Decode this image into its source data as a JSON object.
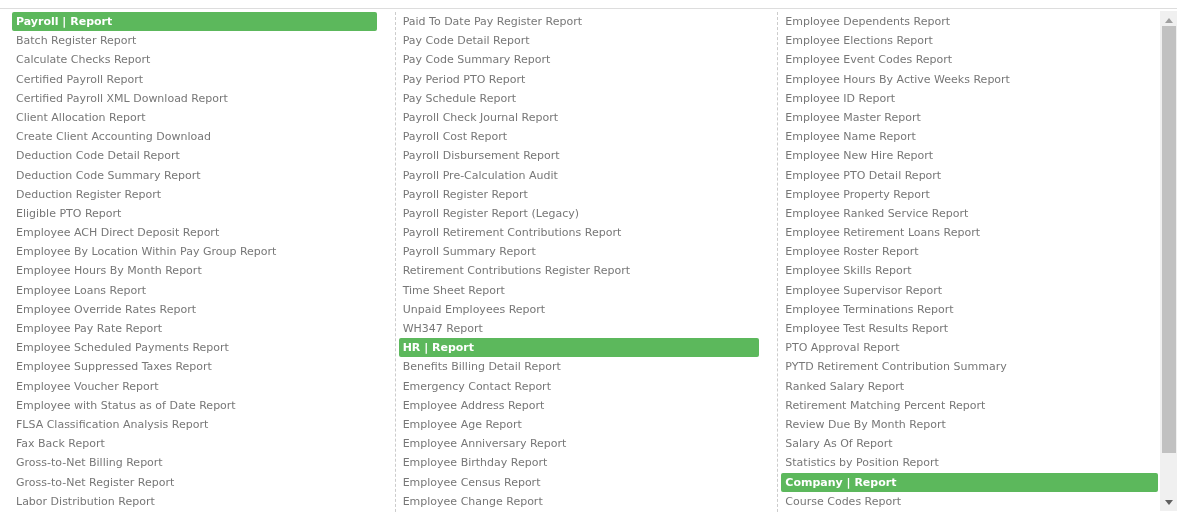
{
  "columns": [
    {
      "items": [
        {
          "label": "Payroll | Report",
          "kind": "header"
        },
        {
          "label": "Batch Register Report",
          "kind": "item"
        },
        {
          "label": "Calculate Checks Report",
          "kind": "item"
        },
        {
          "label": "Certified Payroll Report",
          "kind": "item"
        },
        {
          "label": "Certified Payroll XML Download Report",
          "kind": "item"
        },
        {
          "label": "Client Allocation Report",
          "kind": "item"
        },
        {
          "label": "Create Client Accounting Download",
          "kind": "item"
        },
        {
          "label": "Deduction Code Detail Report",
          "kind": "item"
        },
        {
          "label": "Deduction Code Summary Report",
          "kind": "item"
        },
        {
          "label": "Deduction Register Report",
          "kind": "item"
        },
        {
          "label": "Eligible PTO Report",
          "kind": "item"
        },
        {
          "label": "Employee ACH Direct Deposit Report",
          "kind": "item"
        },
        {
          "label": "Employee By Location Within Pay Group Report",
          "kind": "item"
        },
        {
          "label": "Employee Hours By Month Report",
          "kind": "item"
        },
        {
          "label": "Employee Loans Report",
          "kind": "item"
        },
        {
          "label": "Employee Override Rates Report",
          "kind": "item"
        },
        {
          "label": "Employee Pay Rate Report",
          "kind": "item"
        },
        {
          "label": "Employee Scheduled Payments Report",
          "kind": "item"
        },
        {
          "label": "Employee Suppressed Taxes Report",
          "kind": "item"
        },
        {
          "label": "Employee Voucher Report",
          "kind": "item"
        },
        {
          "label": "Employee with Status as of Date Report",
          "kind": "item"
        },
        {
          "label": "FLSA Classification Analysis Report",
          "kind": "item"
        },
        {
          "label": "Fax Back Report",
          "kind": "item"
        },
        {
          "label": "Gross-to-Net Billing Report",
          "kind": "item"
        },
        {
          "label": "Gross-to-Net Register Report",
          "kind": "item"
        },
        {
          "label": "Labor Distribution Report",
          "kind": "item"
        }
      ]
    },
    {
      "items": [
        {
          "label": "Paid To Date Pay Register Report",
          "kind": "item"
        },
        {
          "label": "Pay Code Detail Report",
          "kind": "item"
        },
        {
          "label": "Pay Code Summary Report",
          "kind": "item"
        },
        {
          "label": "Pay Period PTO Report",
          "kind": "item"
        },
        {
          "label": "Pay Schedule Report",
          "kind": "item"
        },
        {
          "label": "Payroll Check Journal Report",
          "kind": "item"
        },
        {
          "label": "Payroll Cost Report",
          "kind": "item"
        },
        {
          "label": "Payroll Disbursement Report",
          "kind": "item"
        },
        {
          "label": "Payroll Pre-Calculation Audit",
          "kind": "item"
        },
        {
          "label": "Payroll Register Report",
          "kind": "item"
        },
        {
          "label": "Payroll Register Report (Legacy)",
          "kind": "item"
        },
        {
          "label": "Payroll Retirement Contributions Report",
          "kind": "item"
        },
        {
          "label": "Payroll Summary Report",
          "kind": "item"
        },
        {
          "label": "Retirement Contributions Register Report",
          "kind": "item"
        },
        {
          "label": "Time Sheet Report",
          "kind": "item"
        },
        {
          "label": "Unpaid Employees Report",
          "kind": "item"
        },
        {
          "label": "WH347 Report",
          "kind": "item"
        },
        {
          "label": "HR | Report",
          "kind": "header"
        },
        {
          "label": "Benefits Billing Detail Report",
          "kind": "item"
        },
        {
          "label": "Emergency Contact Report",
          "kind": "item"
        },
        {
          "label": "Employee Address Report",
          "kind": "item"
        },
        {
          "label": "Employee Age Report",
          "kind": "item"
        },
        {
          "label": "Employee Anniversary Report",
          "kind": "item"
        },
        {
          "label": "Employee Birthday Report",
          "kind": "item"
        },
        {
          "label": "Employee Census Report",
          "kind": "item"
        },
        {
          "label": "Employee Change Report",
          "kind": "item"
        }
      ]
    },
    {
      "items": [
        {
          "label": "Employee Dependents Report",
          "kind": "item"
        },
        {
          "label": "Employee Elections Report",
          "kind": "item"
        },
        {
          "label": "Employee Event Codes Report",
          "kind": "item"
        },
        {
          "label": "Employee Hours By Active Weeks Report",
          "kind": "item"
        },
        {
          "label": "Employee ID Report",
          "kind": "item"
        },
        {
          "label": "Employee Master Report",
          "kind": "item"
        },
        {
          "label": "Employee Name Report",
          "kind": "item"
        },
        {
          "label": "Employee New Hire Report",
          "kind": "item"
        },
        {
          "label": "Employee PTO Detail Report",
          "kind": "item"
        },
        {
          "label": "Employee Property Report",
          "kind": "item"
        },
        {
          "label": "Employee Ranked Service Report",
          "kind": "item"
        },
        {
          "label": "Employee Retirement Loans Report",
          "kind": "item"
        },
        {
          "label": "Employee Roster Report",
          "kind": "item"
        },
        {
          "label": "Employee Skills Report",
          "kind": "item"
        },
        {
          "label": "Employee Supervisor Report",
          "kind": "item"
        },
        {
          "label": "Employee Terminations Report",
          "kind": "item"
        },
        {
          "label": "Employee Test Results Report",
          "kind": "item"
        },
        {
          "label": "PTO Approval Report",
          "kind": "item"
        },
        {
          "label": "PYTD Retirement Contribution Summary",
          "kind": "item"
        },
        {
          "label": "Ranked Salary Report",
          "kind": "item"
        },
        {
          "label": "Retirement Matching Percent Report",
          "kind": "item"
        },
        {
          "label": "Review Due By Month Report",
          "kind": "item"
        },
        {
          "label": "Salary As Of Report",
          "kind": "item"
        },
        {
          "label": "Statistics by Position Report",
          "kind": "item"
        },
        {
          "label": "Company | Report",
          "kind": "header"
        },
        {
          "label": "Course Codes Report",
          "kind": "item"
        }
      ]
    }
  ]
}
